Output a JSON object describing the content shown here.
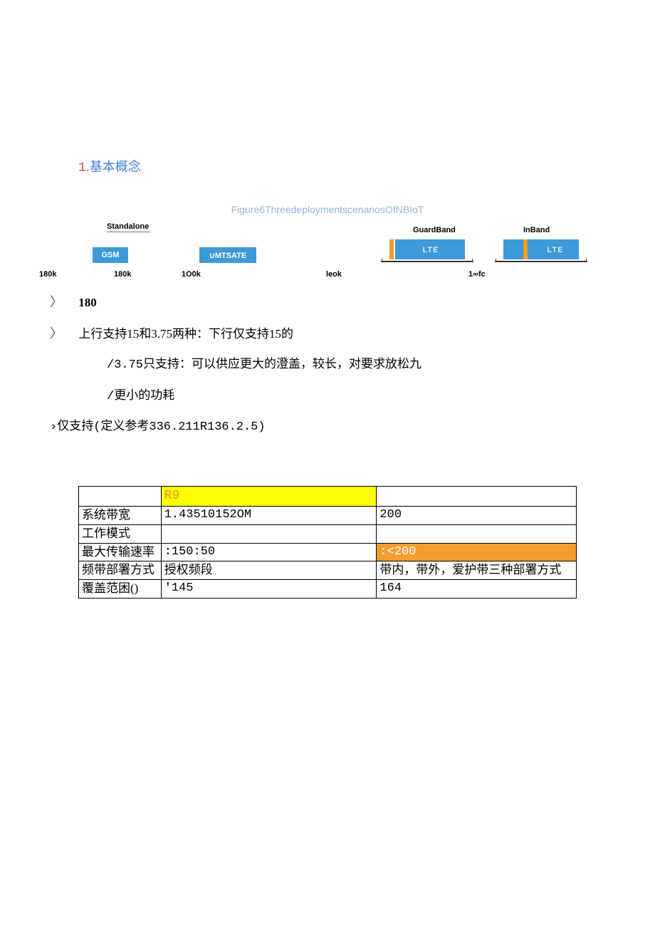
{
  "heading": {
    "num": "1",
    "sep": ".",
    "text": "基本概念"
  },
  "figure": {
    "title": "Figure6ThreedeploymentscenariosOfNBIoT",
    "standalone": "Standalone",
    "gsm": "GSM",
    "umts": "∪MTSATE",
    "guardband": "GuardBand",
    "inband": "InBand",
    "lte": "LTE",
    "k180_a": "180k",
    "k180_b": "180k",
    "k100": "1O0k",
    "leok": "leok",
    "onefc": "1∞fc"
  },
  "lines": {
    "l1a": "〉",
    "l1b": "180",
    "l2a": "〉",
    "l2b": "上行支持15和3.75两种：下行仅支持15的",
    "l3": "/3.75只支持：可以供应更大的澄盖，较长，对要求放松九",
    "l4": "/更小的功耗",
    "l5": "›仅支持(定义参考336.211R136.2.5)"
  },
  "table": {
    "h1": "",
    "h2": "R9",
    "h3": "",
    "rows": [
      {
        "c1": "系统带宽",
        "c2": "1.43510152OM",
        "c3": "200",
        "c2class": "monoc",
        "c3class": "monoc"
      },
      {
        "c1": "工作模式",
        "c2": "",
        "c3": "",
        "c2class": "",
        "c3class": ""
      },
      {
        "c1": "最大传输速率",
        "c2": ":150:50",
        "c3": ":<200",
        "c2class": "monoc",
        "c3class": "orange"
      },
      {
        "c1": "频带部署方式",
        "c2": "授权频段",
        "c3": "带内，带外，爱护带三种部署方式",
        "c2class": "",
        "c3class": ""
      },
      {
        "c1": "覆盖范困()",
        "c2": "'145",
        "c3": "164",
        "c2class": "monoc",
        "c3class": "monoc"
      }
    ]
  }
}
